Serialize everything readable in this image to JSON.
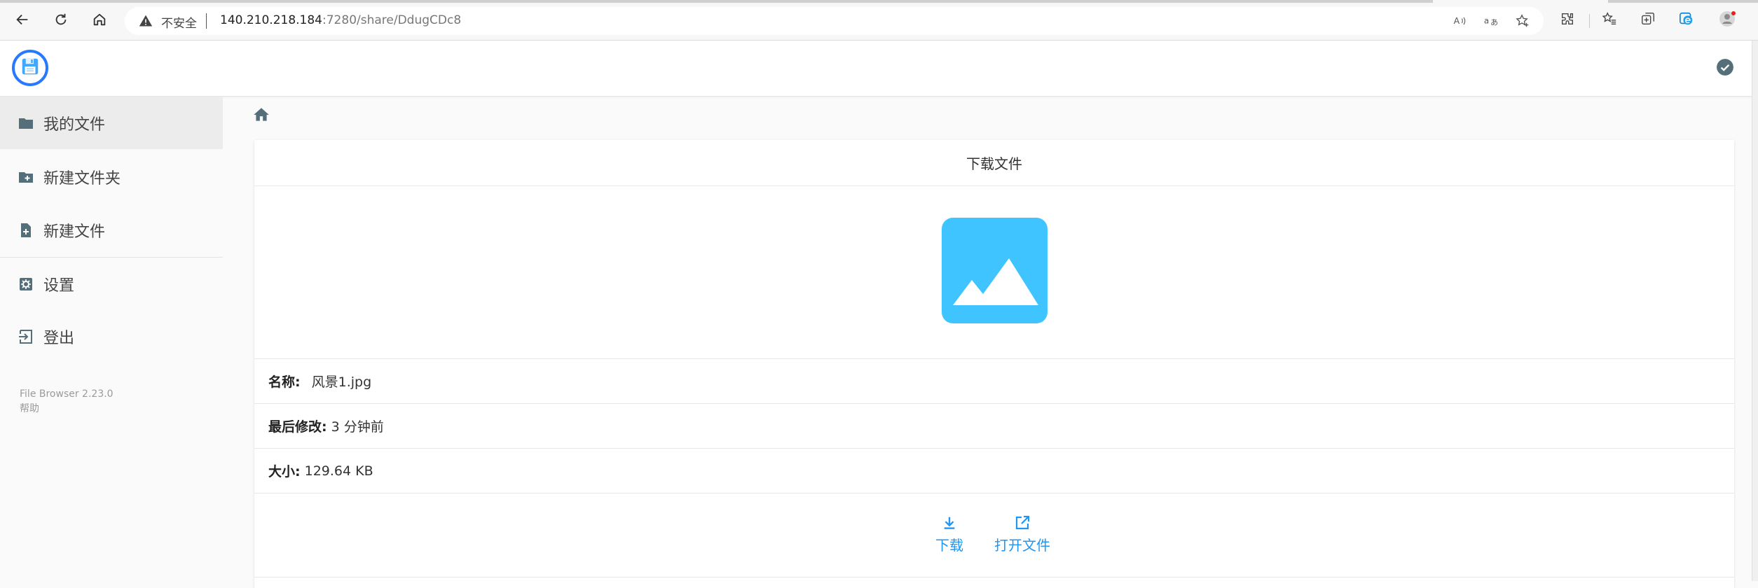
{
  "browser": {
    "insecure_label": "不安全",
    "url_host": "140.210.218.184",
    "url_path": ":7280/share/DdugCDc8",
    "icons": [
      "back-icon",
      "refresh-icon",
      "home-icon",
      "warning-icon",
      "read-aloud-icon",
      "translate-icon",
      "favorite-add-icon",
      "extensions-icon",
      "favorites-icon",
      "collections-icon",
      "edge-icon",
      "profile-icon"
    ]
  },
  "header": {
    "logo_icon": "floppy-disk-icon",
    "status_icon": "check-circle-icon"
  },
  "sidebar": {
    "items": [
      {
        "label": "我的文件",
        "icon": "folder-icon"
      },
      {
        "label": "新建文件夹",
        "icon": "folder-plus-icon"
      },
      {
        "label": "新建文件",
        "icon": "file-plus-icon"
      },
      {
        "label": "设置",
        "icon": "settings-icon"
      },
      {
        "label": "登出",
        "icon": "logout-icon"
      }
    ],
    "version": "File Browser 2.23.0",
    "help": "帮助"
  },
  "breadcrumb": {
    "icon": "home-icon"
  },
  "share": {
    "title": "下载文件",
    "preview_icon": "image-icon",
    "name_label": "名称:",
    "name_value": "风景1.jpg",
    "modified_label": "最后修改:",
    "modified_value": "3 分钟前",
    "size_label": "大小:",
    "size_value": "129.64 KB",
    "download_label": "下载",
    "open_label": "打开文件"
  },
  "colors": {
    "accent": "#2196f3",
    "logo_ring": "#2979ff",
    "preview_bg": "#40c4ff",
    "sidebar_icon": "#546e7a"
  }
}
